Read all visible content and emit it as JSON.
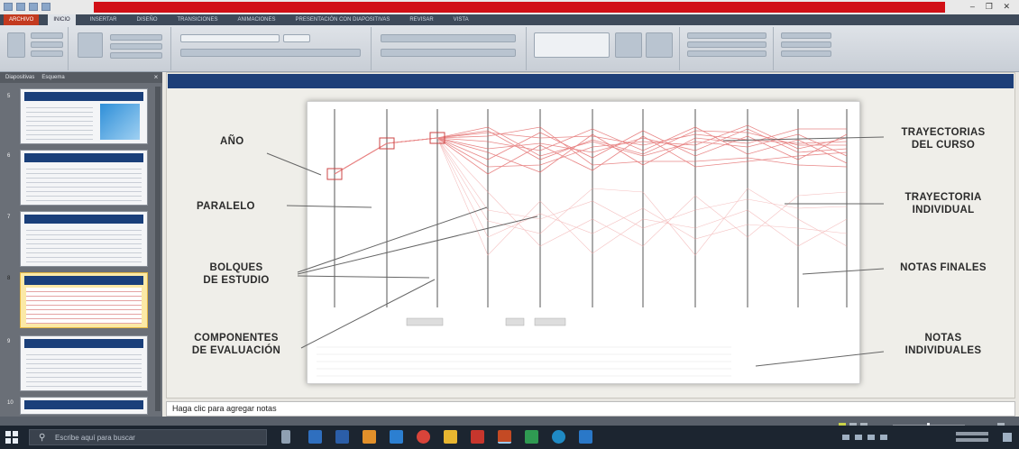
{
  "window": {
    "tabs": [
      "ARCHIVO",
      "INICIO",
      "INSERTAR",
      "DISEÑO",
      "TRANSICIONES",
      "ANIMACIONES",
      "PRESENTACIÓN CON DIAPOSITIVAS",
      "REVISAR",
      "VISTA"
    ],
    "active_tab": "INICIO",
    "title_banner_color": "#d10f16"
  },
  "left_panel": {
    "tabs": [
      "Diapositivas",
      "Esquema"
    ],
    "slide_numbers": [
      "5",
      "6",
      "7",
      "8",
      "9",
      "10"
    ],
    "selected_slide": "8"
  },
  "slide": {
    "labels": {
      "anio": "AÑO",
      "paralelo": "PARALELO",
      "bloques_1": "BOLQUES",
      "bloques_2": "DE ESTUDIO",
      "componentes_1": "COMPONENTES",
      "componentes_2": "DE EVALUACIÓN",
      "trayectorias_1": "TRAYECTORIAS",
      "trayectorias_2": "DEL CURSO",
      "trayectoria_1": "TRAYECTORIA",
      "trayectoria_2": "INDIVIDUAL",
      "notas_finales": "NOTAS FINALES",
      "notas_ind_1": "NOTAS",
      "notas_ind_2": "INDIVIDUALES"
    },
    "header_color": "#1d3f78"
  },
  "notes_placeholder": "Haga clic para agregar notas",
  "taskbar": {
    "search_placeholder": "Escribe aquí para buscar"
  }
}
